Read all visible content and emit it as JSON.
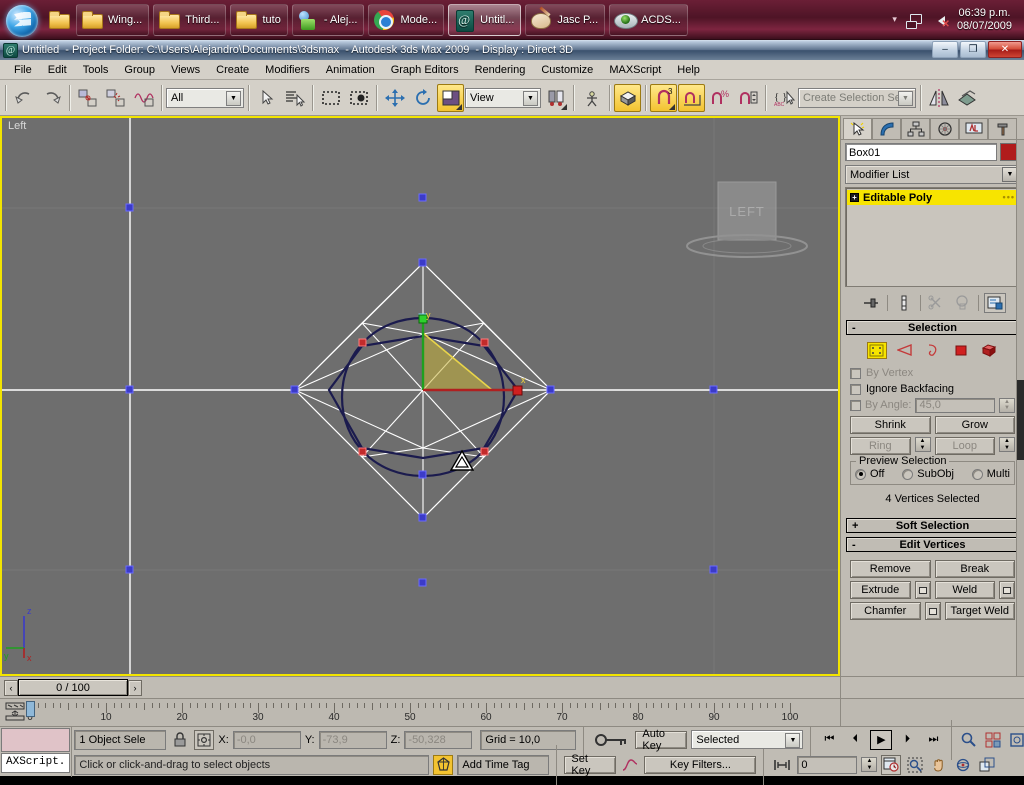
{
  "taskbar": {
    "start_tooltip": "Start",
    "quicklaunch": [
      {
        "icon": "folder-icon",
        "name": "quicklaunch-folder"
      }
    ],
    "buttons": [
      {
        "label": "Wing...",
        "icon": "folder-icon",
        "active": false
      },
      {
        "label": "Third...",
        "icon": "folder-icon",
        "active": false
      },
      {
        "label": "tuto",
        "icon": "folder-icon",
        "active": false
      },
      {
        "label": "- Alej...",
        "icon": "messenger-icon",
        "active": false
      },
      {
        "label": "Mode...",
        "icon": "chrome-icon",
        "active": false
      },
      {
        "label": "Untitl...",
        "icon": "3dsmax-icon",
        "active": true
      },
      {
        "label": "Jasc P...",
        "icon": "paintshop-icon",
        "active": false
      },
      {
        "label": "ACDS...",
        "icon": "acdsee-icon",
        "active": false
      }
    ],
    "tray": {
      "show_hidden": "▾",
      "network_icon": "network-icon",
      "volume_icon": "volume-muted-icon"
    },
    "clock": {
      "time": "06:39 p.m.",
      "date": "08/07/2009"
    }
  },
  "titlebar": {
    "document": "Untitled",
    "project": "- Project Folder: C:\\Users\\Alejandro\\Documents\\3dsmax",
    "app": "- Autodesk 3ds Max  2009",
    "display": "- Display : Direct 3D",
    "minimize": "–",
    "maximize": "❐",
    "close": "✕"
  },
  "menubar": {
    "items": [
      "File",
      "Edit",
      "Tools",
      "Group",
      "Views",
      "Create",
      "Modifiers",
      "Animation",
      "Graph Editors",
      "Rendering",
      "Customize",
      "MAXScript",
      "Help"
    ]
  },
  "toolbar": {
    "undo": "undo-icon",
    "redo": "redo-icon",
    "select_link": "select-and-link-icon",
    "unlink": "unlink-selection-icon",
    "bind": "bind-to-space-warp-icon",
    "filter_value": "All",
    "select_object": "select-object-icon",
    "select_by_name": "select-by-name-icon",
    "select_region": "rectangular-selection-region-icon",
    "window_crossing": "window-crossing-icon",
    "select_move": "select-and-move-icon",
    "select_rotate": "select-and-rotate-icon",
    "ref_coord_icon": "reference-coordinate-icon",
    "ref_coord_value": "View",
    "use_center": "use-pivot-point-center-icon",
    "select_manipulate": "select-and-manipulate-icon",
    "keyboard_shortcut": "keyboard-shortcut-override-icon",
    "snap_toggle": "snaps-toggle-icon",
    "snap_label": "3",
    "angle_snap": "angle-snap-toggle-icon",
    "percent_snap": "percent-snap-toggle-icon",
    "spinner_snap": "spinner-snap-toggle-icon",
    "named_set": "edit-named-selection-sets-icon",
    "selection_set_placeholder": "Create Selection Set",
    "mirror": "mirror-icon",
    "align": "align-icon"
  },
  "viewport": {
    "label": "Left",
    "viewcube_label": "LEFT",
    "axis_labels": {
      "z": "z",
      "y": "y",
      "x": "x"
    },
    "gizmo": {
      "x_label": "x",
      "y_label": "y"
    },
    "background": "#6e6e6e",
    "active_border": "#f2e400"
  },
  "command_panel": {
    "tabs": [
      {
        "name": "create-tab",
        "icon": "create-arrow-icon",
        "selected": true
      },
      {
        "name": "modify-tab",
        "icon": "modify-bend-icon",
        "selected": false
      },
      {
        "name": "hierarchy-tab",
        "icon": "hierarchy-icon",
        "selected": false
      },
      {
        "name": "motion-tab",
        "icon": "motion-wheel-icon",
        "selected": false
      },
      {
        "name": "display-tab",
        "icon": "display-monitor-icon",
        "selected": false
      },
      {
        "name": "utilities-tab",
        "icon": "utilities-hammer-icon",
        "selected": false
      }
    ],
    "object_name": "Box01",
    "object_color": "#b01c1c",
    "modifier_list_label": "Modifier List",
    "stack": [
      {
        "label": "Editable Poly",
        "expanded": true,
        "selected": true
      }
    ],
    "stack_buttons": [
      "pin-stack-icon",
      "show-end-result-icon",
      "make-unique-icon",
      "remove-modifier-icon",
      "configure-modifier-sets-icon"
    ],
    "selection_rollout": {
      "title": "Selection",
      "sign": "-",
      "sub_levels": [
        {
          "name": "vertex-sublevel",
          "selected": true
        },
        {
          "name": "edge-sublevel",
          "selected": false
        },
        {
          "name": "border-sublevel",
          "selected": false
        },
        {
          "name": "polygon-sublevel",
          "selected": false
        },
        {
          "name": "element-sublevel",
          "selected": false
        }
      ],
      "by_vertex": {
        "label": "By Vertex",
        "checked": false,
        "disabled": true
      },
      "ignore_backfacing": {
        "label": "Ignore Backfacing",
        "checked": false,
        "disabled": false
      },
      "by_angle": {
        "label": "By Angle:",
        "checked": false,
        "disabled": true,
        "value": "45,0"
      },
      "shrink": "Shrink",
      "grow": "Grow",
      "ring": "Ring",
      "loop": "Loop",
      "preview_group": "Preview Selection",
      "preview_options": [
        {
          "label": "Off",
          "on": true
        },
        {
          "label": "SubObj",
          "on": false
        },
        {
          "label": "Multi",
          "on": false
        }
      ],
      "status": "4 Vertices Selected"
    },
    "soft_selection_rollout": {
      "title": "Soft Selection",
      "sign": "+"
    },
    "edit_vertices_rollout": {
      "title": "Edit Vertices",
      "sign": "-",
      "buttons": [
        {
          "label": "Remove",
          "settings": false
        },
        {
          "label": "Break",
          "settings": false
        },
        {
          "label": "Extrude",
          "settings": true
        },
        {
          "label": "Weld",
          "settings": true
        },
        {
          "label": "Chamfer",
          "settings": true
        },
        {
          "label": "Target Weld",
          "settings": false
        }
      ]
    }
  },
  "timeslider": {
    "prev": "‹",
    "next": "›",
    "value": "0 / 100"
  },
  "trackbar": {
    "icon": "track-view-icon",
    "ticks": [
      0,
      10,
      20,
      30,
      40,
      50,
      60,
      70,
      80,
      90,
      100
    ],
    "playhead_frame": 0
  },
  "statusbar": {
    "listener_text": "AXScript.",
    "selection": "1 Object Sele",
    "lock_icon": "selection-lock-icon",
    "absolute_icon": "absolute-relative-transform-icon",
    "coords": [
      {
        "axis": "X:",
        "value": "-0,0"
      },
      {
        "axis": "Y:",
        "value": "-73,9"
      },
      {
        "axis": "Z:",
        "value": "-50,328"
      }
    ],
    "grid": "Grid = 10,0",
    "prompt": "Click or click-and-drag to select objects",
    "time_tag_icon": "time-tag-icon",
    "add_time_tag": "Add Time Tag",
    "key_mode_icon": "key-mode-toggle-icon",
    "auto_key": "Auto Key",
    "set_key": "Set Key",
    "filter_value": "Selected",
    "key_filters": "Key Filters...",
    "curve_icon": "default-in-out-tangent-icon",
    "playback": [
      {
        "name": "goto-start-button",
        "glyph": "⏮"
      },
      {
        "name": "previous-frame-button",
        "glyph": "⏴"
      },
      {
        "name": "play-animation-button",
        "glyph": "▶",
        "active": true
      },
      {
        "name": "next-frame-button",
        "glyph": "⏵"
      },
      {
        "name": "goto-end-button",
        "glyph": "⏭"
      }
    ],
    "frame_field": "0",
    "key_mode_btn": "key-mode-toggle-icon",
    "time_config_icon": "time-configuration-icon",
    "nav_icons": [
      "zoom-icon",
      "zoom-all-icon",
      "zoom-extents-icon",
      "zoom-extents-all-icon",
      "region-zoom-icon",
      "pan-view-icon",
      "orbit-icon",
      "maximize-viewport-toggle-icon"
    ]
  }
}
